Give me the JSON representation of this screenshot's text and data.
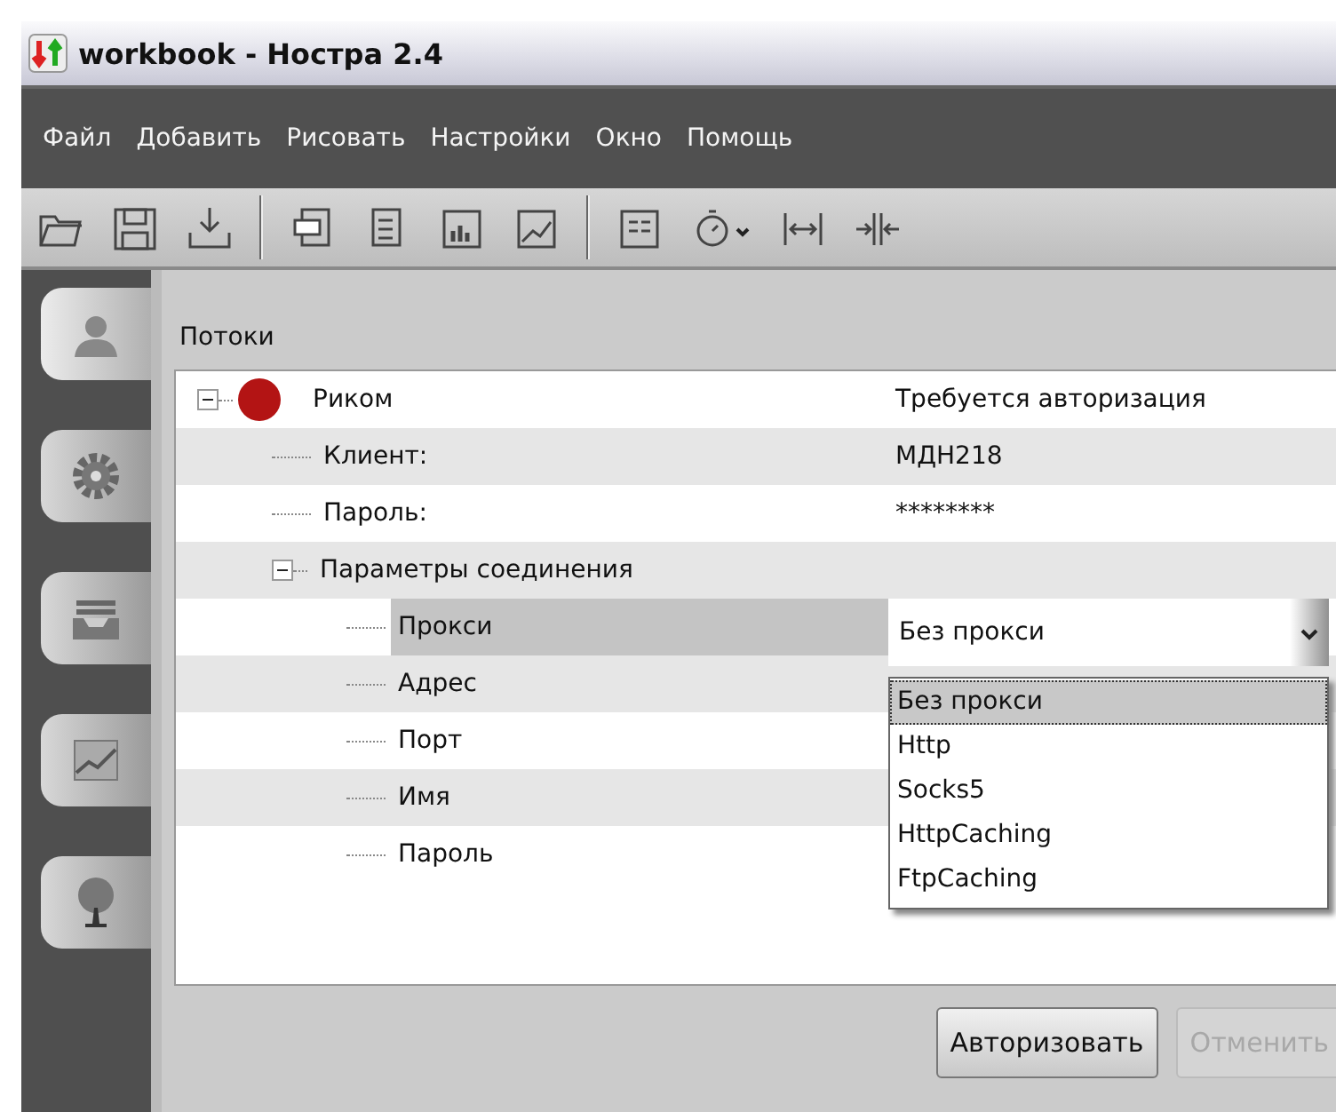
{
  "window": {
    "title": "workbook - Ностра 2.4"
  },
  "menu": [
    {
      "label": "Файл"
    },
    {
      "label": "Добавить"
    },
    {
      "label": "Рисовать"
    },
    {
      "label": "Настройки"
    },
    {
      "label": "Окно"
    },
    {
      "label": "Помощь"
    }
  ],
  "sidebar": {
    "tabs": [
      {
        "kind": "user",
        "selected": true
      },
      {
        "kind": "settings",
        "selected": false
      },
      {
        "kind": "tray",
        "selected": false
      },
      {
        "kind": "chart",
        "selected": false
      },
      {
        "kind": "tree",
        "selected": false
      }
    ]
  },
  "panel": {
    "title": "Потоки",
    "tree": [
      {
        "label": "Риком",
        "value": "Требуется авторизация",
        "color": "#b31414",
        "expanded": true,
        "selected": false,
        "children": [
          {
            "label": "Клиент:",
            "value": "МДН218",
            "selected": false
          },
          {
            "label": "Пароль:",
            "value": "********",
            "selected": false
          },
          {
            "label": "Параметры соединения",
            "expanded": true,
            "selected": false,
            "children": [
              {
                "label": "Прокси",
                "selected": true,
                "dropdown": {
                  "value": "Без прокси",
                  "expanded": true,
                  "options": [
                    {
                      "label": "Без прокси",
                      "selected": true
                    },
                    {
                      "label": "Http",
                      "selected": false
                    },
                    {
                      "label": "Socks5",
                      "selected": false
                    },
                    {
                      "label": "HttpCaching",
                      "selected": false
                    },
                    {
                      "label": "FtpCaching",
                      "selected": false
                    }
                  ]
                }
              },
              {
                "label": "Адрес",
                "selected": false
              },
              {
                "label": "Порт",
                "selected": false
              },
              {
                "label": "Имя",
                "selected": false
              },
              {
                "label": "Пароль",
                "selected": false
              }
            ]
          }
        ]
      }
    ]
  },
  "buttons": [
    {
      "label": "Авторизовать",
      "disabled": false
    },
    {
      "label": "Отменить",
      "disabled": true
    }
  ]
}
